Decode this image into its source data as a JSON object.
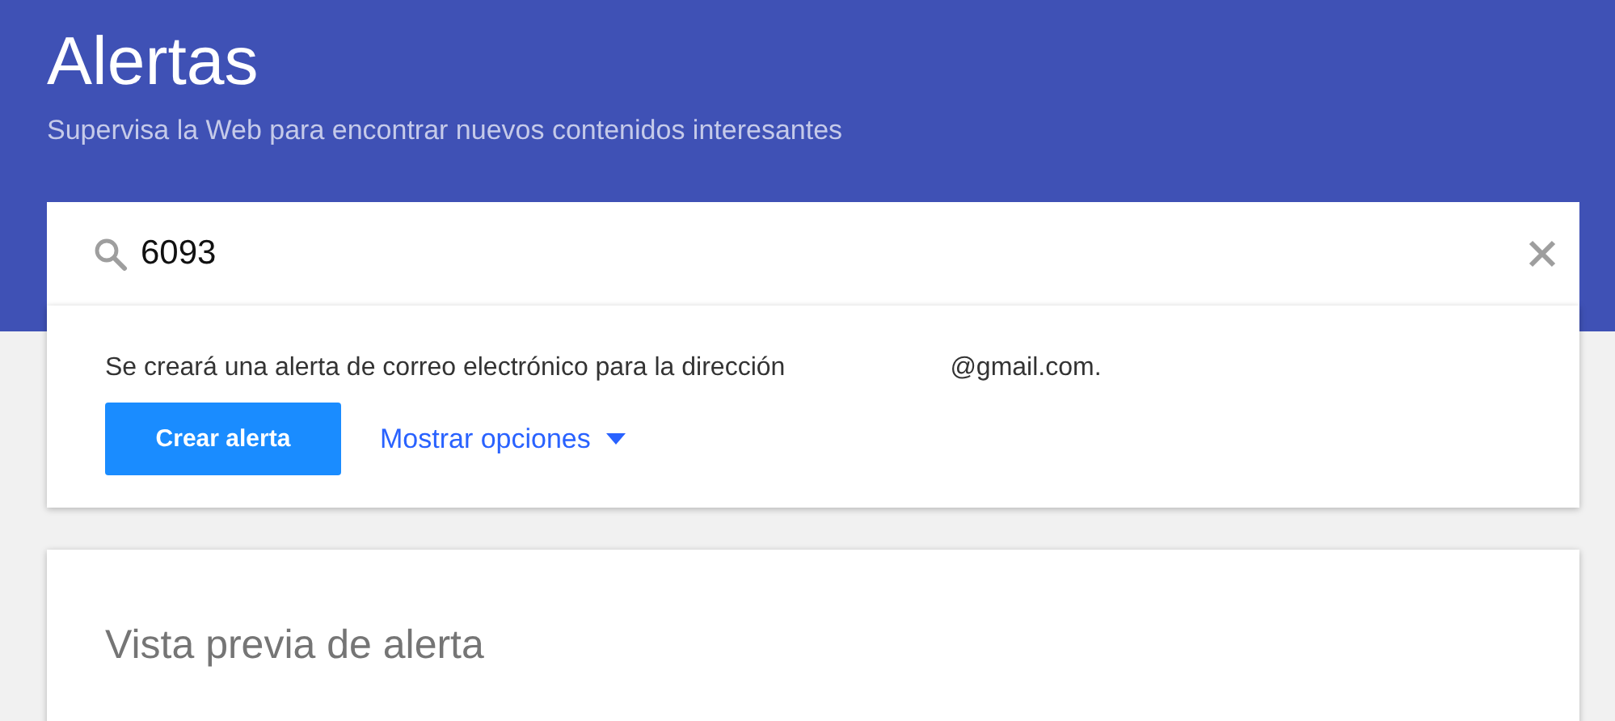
{
  "header": {
    "title": "Alertas",
    "subtitle": "Supervisa la Web para encontrar nuevos contenidos interesantes"
  },
  "search": {
    "value": "6093"
  },
  "alert_card": {
    "message": "Se creará una alerta de correo electrónico para la dirección",
    "email": "@gmail.com.",
    "create_button": "Crear alerta",
    "options_link": "Mostrar opciones"
  },
  "preview": {
    "title": "Vista previa de alerta"
  }
}
